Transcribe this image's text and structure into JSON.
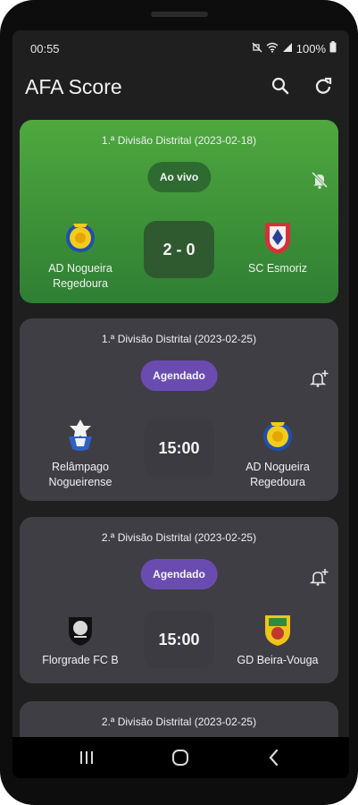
{
  "status": {
    "time": "00:55",
    "battery": "100%"
  },
  "appbar": {
    "title": "AFA Score",
    "search_icon": "search-icon",
    "refresh_icon": "refresh-icon"
  },
  "matches": [
    {
      "league": "1.ª Divisão Distrital (2023-02-18)",
      "badge": "Ao vivo",
      "state": "live",
      "center": "2 - 0",
      "home": "AD Nogueira Regedoura",
      "away": "SC Esmoriz",
      "bell": "notifications-off-icon"
    },
    {
      "league": "1.ª Divisão Distrital (2023-02-25)",
      "badge": "Agendado",
      "state": "scheduled",
      "center": "15:00",
      "home": "Relâmpago Nogueirense",
      "away": "AD Nogueira Regedoura",
      "bell": "add-alert-icon"
    },
    {
      "league": "2.ª Divisão Distrital (2023-02-25)",
      "badge": "Agendado",
      "state": "scheduled",
      "center": "15:00",
      "home": "Florgrade FC B",
      "away": "GD Beira-Vouga",
      "bell": "add-alert-icon"
    },
    {
      "league": "2.ª Divisão Distrital (2023-02-25)",
      "badge": "",
      "state": "scheduled",
      "center": "",
      "home": "",
      "away": "",
      "bell": ""
    }
  ],
  "colors": {
    "live_green": "#43a047",
    "scheduled_badge": "#6a4cb0",
    "card_bg": "#403e45",
    "screen_bg": "#1f1f1f"
  }
}
